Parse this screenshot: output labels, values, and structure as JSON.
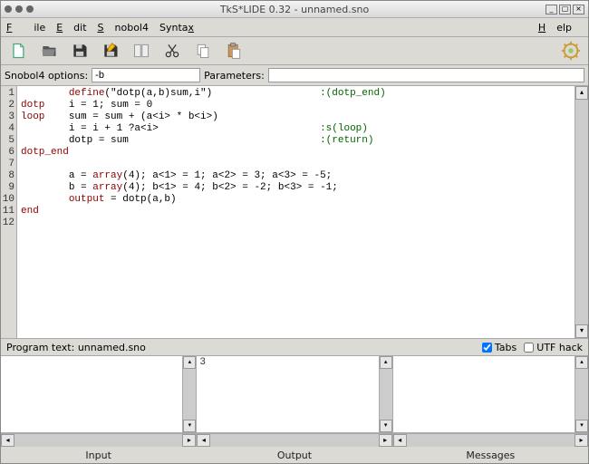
{
  "window": {
    "title": "TkS*LIDE 0.32 - unnamed.sno"
  },
  "menu": {
    "file": "File",
    "edit": "Edit",
    "snobol": "Snobol4",
    "syntax": "Syntax",
    "help": "Help"
  },
  "options": {
    "label": "Snobol4 options:",
    "value": "-b",
    "param_label": "Parameters:",
    "param_value": ""
  },
  "editor": {
    "lines": [
      {
        "n": "1",
        "label": "",
        "indent": "        ",
        "segs": [
          {
            "c": "kw",
            "t": "define"
          },
          {
            "c": "",
            "t": "(\"dotp(a,b)sum,i\")"
          }
        ],
        "goto": ":(dotp_end)",
        "goto_col": 50
      },
      {
        "n": "2",
        "label": "dotp",
        "indent": "    ",
        "segs": [
          {
            "c": "",
            "t": "i = 1; sum = 0"
          }
        ]
      },
      {
        "n": "3",
        "label": "loop",
        "indent": "    ",
        "segs": [
          {
            "c": "",
            "t": "sum = sum + (a<i> * b<i>)"
          }
        ]
      },
      {
        "n": "4",
        "label": "",
        "indent": "        ",
        "segs": [
          {
            "c": "",
            "t": "i = i + 1 ?a<i>"
          }
        ],
        "goto": ":s(loop)",
        "goto_col": 50
      },
      {
        "n": "5",
        "label": "",
        "indent": "        ",
        "segs": [
          {
            "c": "",
            "t": "dotp = sum"
          }
        ],
        "goto": ":(return)",
        "goto_col": 50
      },
      {
        "n": "6",
        "label": "dotp_end",
        "indent": "",
        "segs": []
      },
      {
        "n": "7",
        "label": "",
        "indent": "",
        "segs": []
      },
      {
        "n": "8",
        "label": "",
        "indent": "        ",
        "segs": [
          {
            "c": "",
            "t": "a = "
          },
          {
            "c": "kw",
            "t": "array"
          },
          {
            "c": "",
            "t": "(4); a<1> = 1; a<2> = 3; a<3> = -5;"
          }
        ]
      },
      {
        "n": "9",
        "label": "",
        "indent": "        ",
        "segs": [
          {
            "c": "",
            "t": "b = "
          },
          {
            "c": "kw",
            "t": "array"
          },
          {
            "c": "",
            "t": "(4); b<1> = 4; b<2> = -2; b<3> = -1;"
          }
        ]
      },
      {
        "n": "10",
        "label": "",
        "indent": "        ",
        "segs": [
          {
            "c": "kw",
            "t": "output"
          },
          {
            "c": "",
            "t": " = dotp(a,b)"
          }
        ]
      },
      {
        "n": "11",
        "label": "end",
        "indent": "",
        "segs": []
      },
      {
        "n": "12",
        "label": "",
        "indent": "",
        "segs": []
      }
    ]
  },
  "status": {
    "program_label": "Program text:",
    "filename": "unnamed.sno",
    "tabs_label": "Tabs",
    "tabs_checked": true,
    "utf_label": "UTF hack",
    "utf_checked": false
  },
  "panes": {
    "input": "Input",
    "output": "Output",
    "messages": "Messages",
    "output_content": "3"
  }
}
